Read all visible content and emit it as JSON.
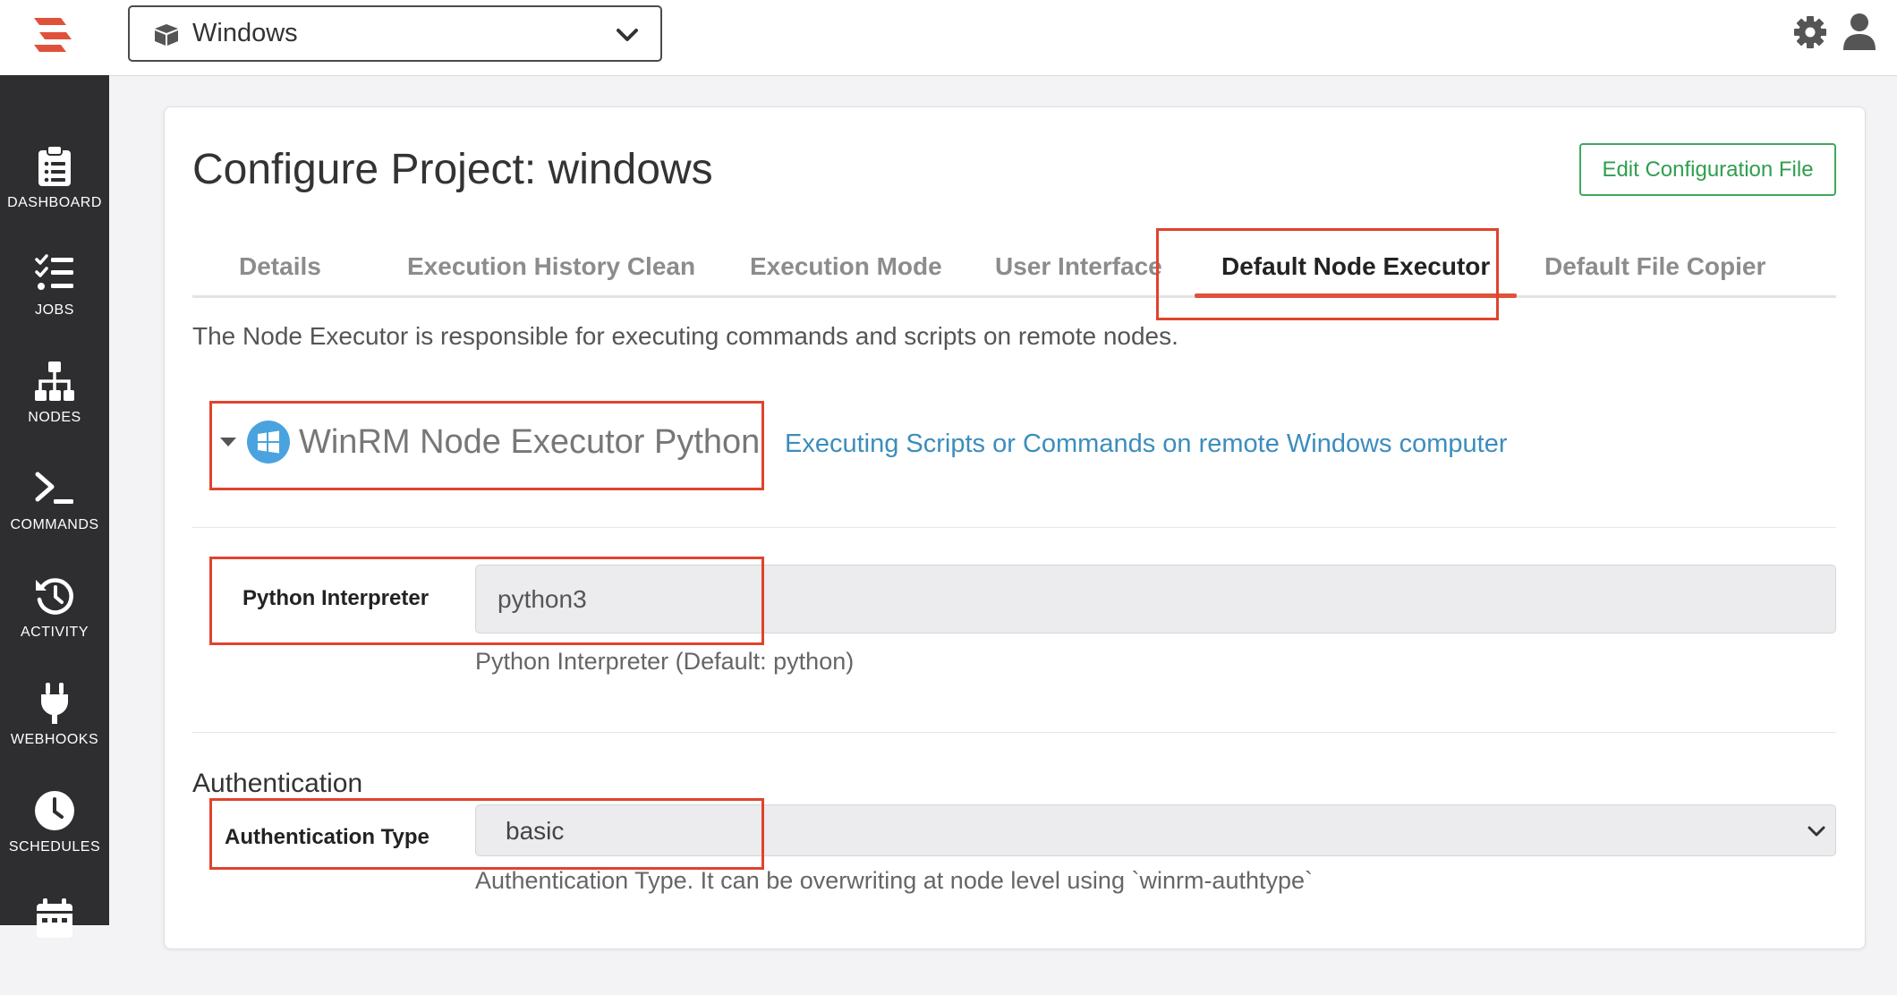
{
  "header": {
    "project_name": "Windows",
    "icons": [
      "rundeck-logo-icon",
      "box-icon",
      "chevron-down-icon",
      "gear-icon",
      "user-icon"
    ]
  },
  "sidebar": {
    "items": [
      {
        "label": "DASHBOARD",
        "icon": "clipboard-icon"
      },
      {
        "label": "JOBS",
        "icon": "list-check-icon"
      },
      {
        "label": "NODES",
        "icon": "sitemap-icon"
      },
      {
        "label": "COMMANDS",
        "icon": "terminal-icon"
      },
      {
        "label": "ACTIVITY",
        "icon": "history-icon"
      },
      {
        "label": "WEBHOOKS",
        "icon": "plug-icon"
      },
      {
        "label": "SCHEDULES",
        "icon": "clock-icon"
      },
      {
        "label": "",
        "icon": "calendar-icon"
      }
    ]
  },
  "page": {
    "title": "Configure Project: windows",
    "edit_button": "Edit Configuration File",
    "tabs": [
      {
        "label": "Details"
      },
      {
        "label": "Execution History Clean"
      },
      {
        "label": "Execution Mode"
      },
      {
        "label": "User Interface"
      },
      {
        "label": "Default Node Executor",
        "active": true
      },
      {
        "label": "Default File Copier"
      }
    ],
    "description": "The Node Executor is responsible for executing commands and scripts on remote nodes.",
    "executor": {
      "name": "WinRM Node Executor Python",
      "link_text": "Executing Scripts or Commands on remote Windows computer"
    },
    "python_interpreter": {
      "label": "Python Interpreter",
      "value": "python3",
      "help": "Python Interpreter (Default: python)"
    },
    "authentication": {
      "section_title": "Authentication",
      "type_label": "Authentication Type",
      "type_value": "basic",
      "help": "Authentication Type. It can be overwriting at node level using `winrm-authtype`"
    }
  },
  "colors": {
    "highlight": "#e0432e",
    "sidebar_bg": "#2e2e30",
    "link": "#3c8dbc",
    "edit_button": "#2f9e4f",
    "logo": "#e0513b"
  }
}
